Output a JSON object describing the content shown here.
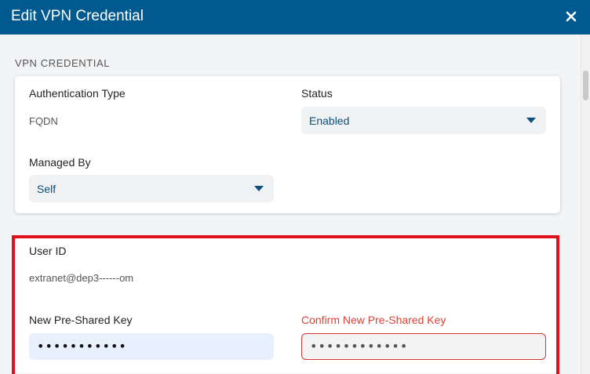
{
  "header": {
    "title": "Edit VPN Credential"
  },
  "section": {
    "title": "VPN CREDENTIAL"
  },
  "auth": {
    "label": "Authentication Type",
    "value": "FQDN"
  },
  "status": {
    "label": "Status",
    "selected": "Enabled"
  },
  "managed_by": {
    "label": "Managed By",
    "selected": "Self"
  },
  "user_id": {
    "label": "User ID",
    "value": "extranet@dep3‐‐‐‐‐‐om"
  },
  "psk": {
    "label": "New Pre-Shared Key",
    "value": "•••••••••••"
  },
  "confirm_psk": {
    "label": "Confirm New Pre-Shared Key",
    "value": "••••••••••••"
  },
  "icons": {
    "close": "close-icon",
    "caret": "chevron-down-icon"
  },
  "colors": {
    "header": "#005a8f",
    "accent_text": "#0b4f7c",
    "error": "#d94336",
    "highlight": "#e0121f"
  }
}
